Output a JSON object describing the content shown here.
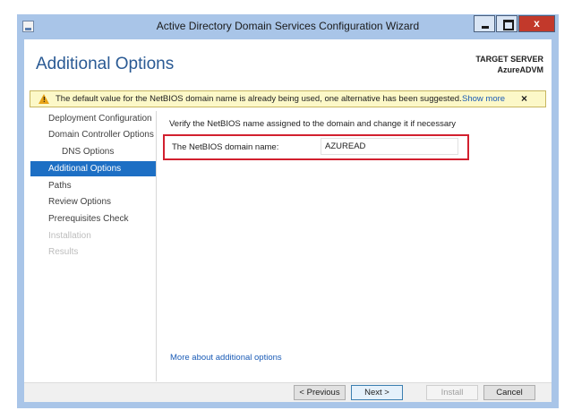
{
  "window": {
    "title": "Active Directory Domain Services Configuration Wizard"
  },
  "titlebar_buttons": {
    "minimize": "–",
    "maximize": "□",
    "close": "x"
  },
  "header": {
    "page_title": "Additional Options",
    "target_label": "TARGET SERVER",
    "target_name": "AzureADVM"
  },
  "warning": {
    "text": "The default value for the NetBIOS domain name is already being used, one alternative has been suggested.",
    "show_more": "Show more",
    "close": "×"
  },
  "nav": {
    "items": [
      {
        "label": "Deployment Configuration",
        "state": "normal"
      },
      {
        "label": "Domain Controller Options",
        "state": "normal"
      },
      {
        "label": "DNS Options",
        "state": "sub"
      },
      {
        "label": "Additional Options",
        "state": "active"
      },
      {
        "label": "Paths",
        "state": "normal"
      },
      {
        "label": "Review Options",
        "state": "normal"
      },
      {
        "label": "Prerequisites Check",
        "state": "normal"
      },
      {
        "label": "Installation",
        "state": "disabled"
      },
      {
        "label": "Results",
        "state": "disabled"
      }
    ]
  },
  "content": {
    "description": "Verify the NetBIOS name assigned to the domain and change it if necessary",
    "netbios_label": "The NetBIOS domain name:",
    "netbios_value": "AZUREAD",
    "more_link": "More about additional options"
  },
  "footer": {
    "previous": "< Previous",
    "next": "Next >",
    "install": "Install",
    "cancel": "Cancel"
  },
  "colors": {
    "accent": "#1d6fc4",
    "highlight_border": "#d2202f",
    "title": "#2a5a94"
  }
}
